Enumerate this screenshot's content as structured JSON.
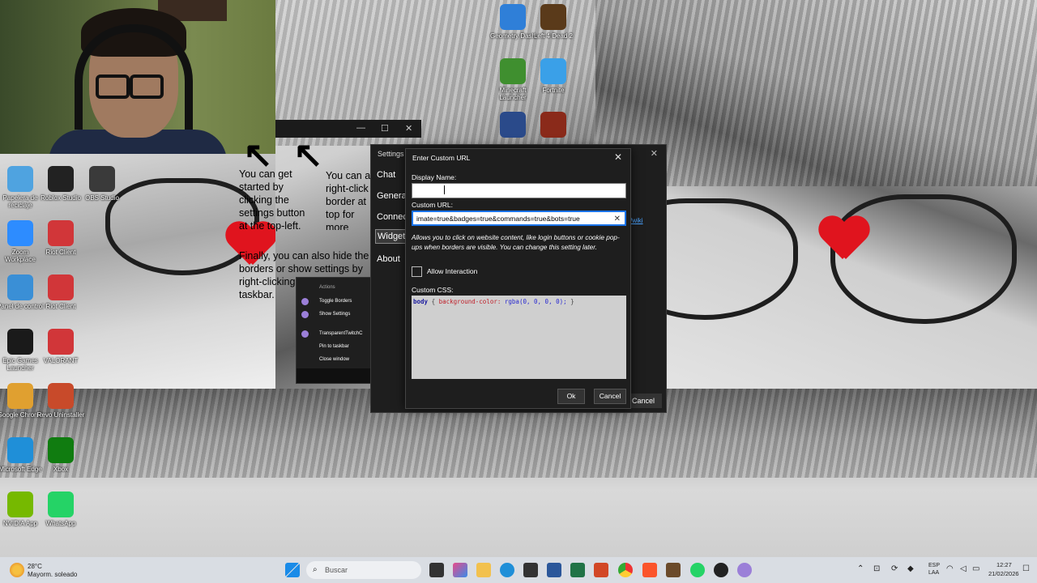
{
  "desktop": {
    "icons_left": [
      {
        "label": "Papelera de reciclaje",
        "icon": "recycle-bin-icon",
        "color": "#4fa3e0"
      },
      {
        "label": "Roblox Studio",
        "icon": "roblox-studio-icon",
        "color": "#222222"
      },
      {
        "label": "OBS Studio",
        "icon": "obs-icon",
        "color": "#3a3a3a"
      },
      {
        "label": "Zoom Workplace",
        "icon": "zoom-icon",
        "color": "#2d8cff"
      },
      {
        "label": "Riot Client",
        "icon": "riot-client-icon",
        "color": "#d13639"
      },
      {
        "label": "Panel de control",
        "icon": "control-panel-icon",
        "color": "#3a8fd6"
      },
      {
        "label": "Riot Client",
        "icon": "riot-client-icon",
        "color": "#d13639"
      },
      {
        "label": "Epic Games Launcher",
        "icon": "epic-games-icon",
        "color": "#1a1a1a"
      },
      {
        "label": "VALORANT",
        "icon": "valorant-icon",
        "color": "#d13639"
      },
      {
        "label": "Google Chrome",
        "icon": "chrome-icon",
        "color": "#e0a030"
      },
      {
        "label": "Revo Uninstaller",
        "icon": "revo-uninstaller-icon",
        "color": "#c84a2a"
      },
      {
        "label": "Microsoft Edge",
        "icon": "edge-icon",
        "color": "#1f8fd8"
      },
      {
        "label": "Xbox",
        "icon": "xbox-icon",
        "color": "#107c10"
      },
      {
        "label": "NVIDIA App",
        "icon": "nvidia-icon",
        "color": "#76b900"
      },
      {
        "label": "WhatsApp",
        "icon": "whatsapp-icon",
        "color": "#25d366"
      }
    ],
    "icons_top": [
      {
        "label": "Geometry Dash",
        "icon": "geometry-dash-icon",
        "color": "#2f7fd8"
      },
      {
        "label": "Left 4 Dead 2",
        "icon": "left4dead-icon",
        "color": "#5a3a1a"
      },
      {
        "label": "Minecraft Launcher",
        "icon": "minecraft-icon",
        "color": "#3f8f2f"
      },
      {
        "label": "Fortnite",
        "icon": "fortnite-icon",
        "color": "#3aa0e8"
      },
      {
        "label": "",
        "icon": "game-icon",
        "color": "#2a4a8a"
      },
      {
        "label": "",
        "icon": "fnaf-icon",
        "color": "#8a2a1a"
      }
    ]
  },
  "tutorial": {
    "text1": "You can get started by clicking the settings button at the top-left.",
    "text2": "You can a right-click border at top for more settings.",
    "text3": "Finally, you can also hide the borders or show settings by right-clicking the icon in your taskbar."
  },
  "context_menu": {
    "header": "Actions",
    "items": [
      "Toggle Borders",
      "Show Settings",
      "TransparentTwitchC",
      "Pin to taskbar",
      "Close window"
    ]
  },
  "settings": {
    "title": "Settings",
    "nav": [
      "Chat",
      "General",
      "Connect",
      "Widgets",
      "About"
    ],
    "selected": "Widgets",
    "wiki_link": "/wiki",
    "cancel_label": "Cancel"
  },
  "dialog": {
    "title": "Enter Custom URL",
    "display_name_label": "Display Name:",
    "display_name_value": "",
    "custom_url_label": "Custom URL:",
    "custom_url_value": "imate=true&badges=true&commands=true&bots=true",
    "clear_glyph": "✕",
    "note": "Allows you to click on website content, like login buttons or cookie pop-ups when borders are visible. You can change this setting later.",
    "allow_interaction_label": "Allow Interaction",
    "allow_interaction_checked": false,
    "custom_css_label": "Custom CSS:",
    "custom_css": {
      "selector": "body",
      "open": "{",
      "property": "background-color:",
      "value": "rgba(0, 0, 0, 0);",
      "close": "}"
    },
    "ok_label": "Ok",
    "cancel_label": "Cancel"
  },
  "taskbar": {
    "weather_temp": "28°C",
    "weather_desc": "Mayorm. soleado",
    "search_placeholder": "Buscar",
    "lang_top": "ESP",
    "lang_bottom": "LAA",
    "time": "12:27",
    "date": "21/02/2026"
  }
}
